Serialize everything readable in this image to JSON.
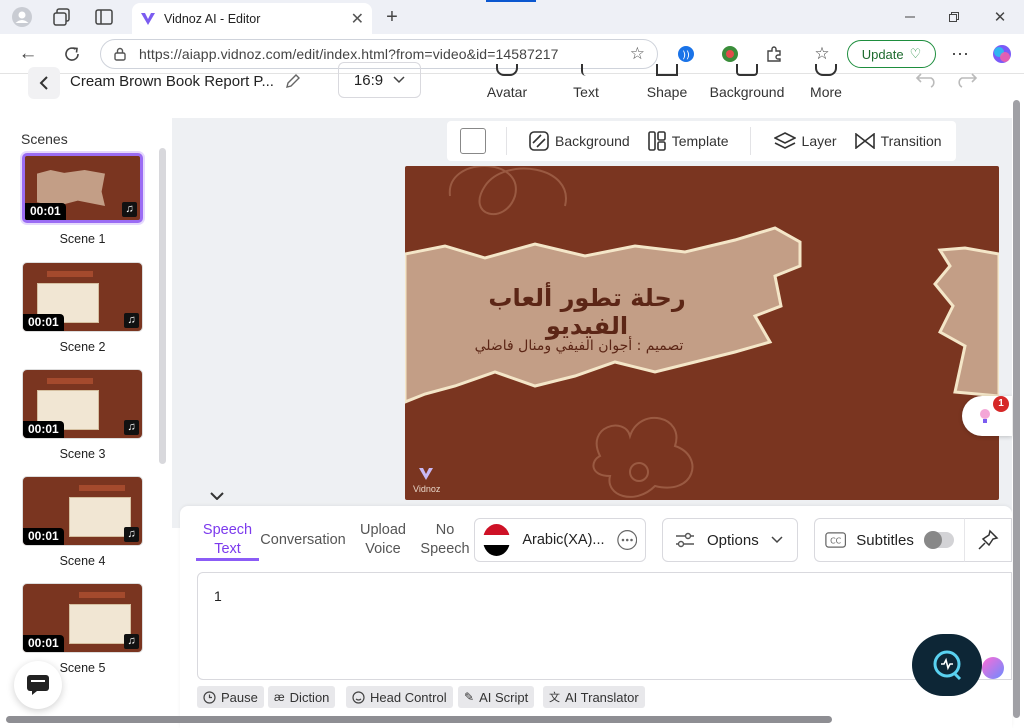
{
  "browser": {
    "tab_title": "Vidnoz AI - Editor",
    "url": "https://aiapp.vidnoz.com/edit/index.html?from=video&id=14587217",
    "update_label": "Update"
  },
  "editor": {
    "project_title": "Cream Brown Book Report P...",
    "aspect_ratio": "16:9",
    "tools": [
      "Avatar",
      "Text",
      "Shape",
      "Background",
      "More"
    ]
  },
  "context_bar": {
    "background_label": "Background",
    "template_label": "Template",
    "layer_label": "Layer",
    "transition_label": "Transition"
  },
  "scenes": {
    "title": "Scenes",
    "items": [
      {
        "label": "Scene 1",
        "time": "00:01",
        "selected": true
      },
      {
        "label": "Scene 2",
        "time": "00:01",
        "selected": false
      },
      {
        "label": "Scene 3",
        "time": "00:01",
        "selected": false
      },
      {
        "label": "Scene 4",
        "time": "00:01",
        "selected": false
      },
      {
        "label": "Scene 5",
        "time": "00:01",
        "selected": false
      }
    ]
  },
  "slide": {
    "title": "رحلة تطور ألعاب الفيديو",
    "subtitle": "تصميم : أجوان الفيفي ومنال فاضلي",
    "brand": "Vidnoz",
    "background_color": "#7a3520",
    "paper_color": "#c39e86"
  },
  "floating_badge": {
    "count": "1"
  },
  "speech": {
    "modes": [
      {
        "line1": "Speech",
        "line2": "Text"
      },
      {
        "line1": "Conversation",
        "line2": ""
      },
      {
        "line1": "Upload",
        "line2": "Voice"
      },
      {
        "line1": "No",
        "line2": "Speech"
      }
    ],
    "voice_label": "Arabic(XA)...",
    "options_label": "Options",
    "subtitles_label": "Subtitles",
    "script_text": "1",
    "chips": [
      "Pause",
      "Diction",
      "Head Control",
      "AI Script",
      "AI Translator"
    ]
  }
}
